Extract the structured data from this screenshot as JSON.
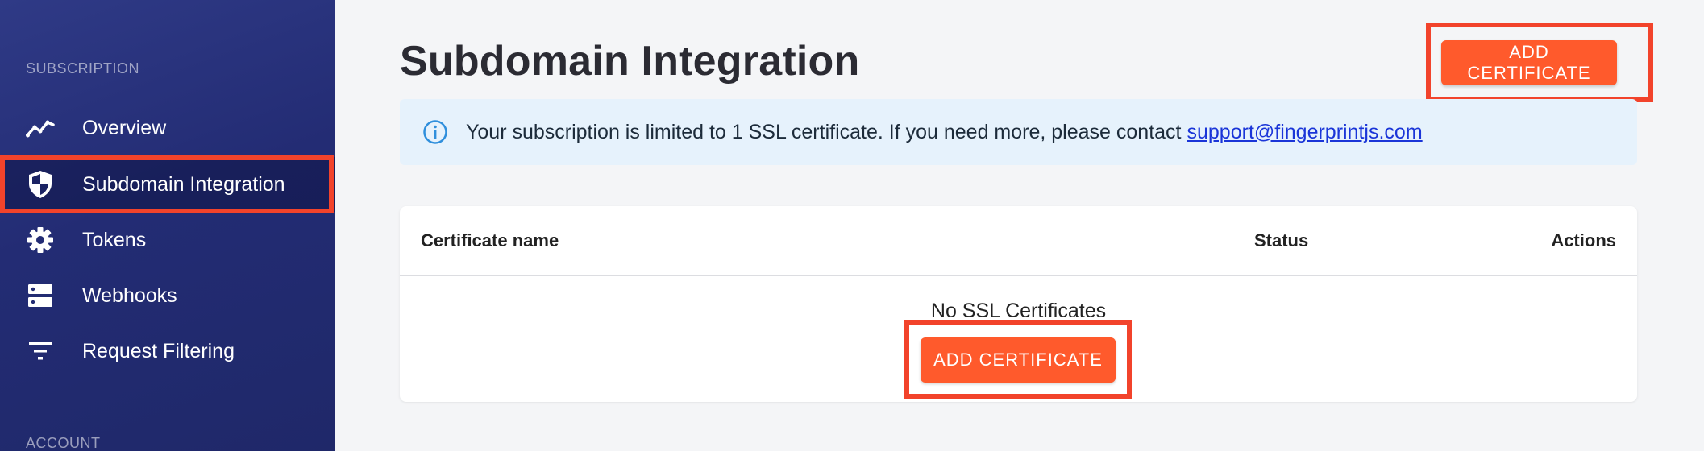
{
  "sidebar": {
    "section_subscription": "SUBSCRIPTION",
    "section_account": "ACCOUNT",
    "items": [
      {
        "label": "Overview",
        "icon": "trending-line-icon"
      },
      {
        "label": "Subdomain Integration",
        "icon": "shield-icon",
        "active": true
      },
      {
        "label": "Tokens",
        "icon": "gear-icon"
      },
      {
        "label": "Webhooks",
        "icon": "server-icon"
      },
      {
        "label": "Request Filtering",
        "icon": "filter-icon"
      }
    ]
  },
  "main": {
    "title": "Subdomain Integration",
    "add_certificate_label": "ADD CERTIFICATE",
    "info_banner": {
      "text": "Your subscription is limited to 1 SSL certificate. If you need more, please contact",
      "link": "support@fingerprintjs.com"
    },
    "table": {
      "columns": [
        "Certificate name",
        "Status",
        "Actions"
      ],
      "empty_text": "No SSL Certificates",
      "empty_action_label": "ADD CERTIFICATE"
    }
  },
  "colors": {
    "sidebar_bg": "#232c74",
    "accent": "#ff5a2c",
    "highlight": "#f2432b",
    "banner_bg": "#e6f2fc",
    "link": "#1a35d8"
  }
}
